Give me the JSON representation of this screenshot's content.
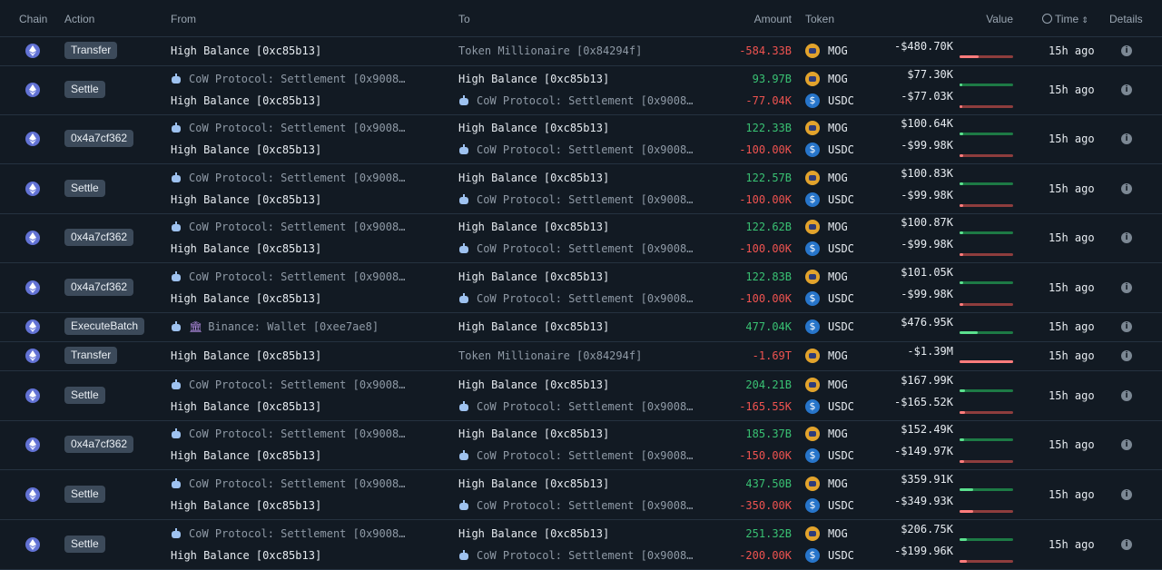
{
  "columns": {
    "chain": "Chain",
    "action": "Action",
    "from": "From",
    "to": "To",
    "amount": "Amount",
    "token": "Token",
    "value": "Value",
    "time": "Time",
    "details": "Details"
  },
  "rows": [
    {
      "action": "Transfer",
      "time": "15h ago",
      "lines": [
        {
          "from": "High Balance [0xc85b13]",
          "from_icon": "none",
          "to": "Token Millionaire [0x84294f]",
          "to_icon": "none",
          "to_dim": true,
          "amount": "-584.33B",
          "sign": "neg",
          "token": "MOG",
          "value": "-$480.70K",
          "fill": 0.35
        }
      ]
    },
    {
      "action": "Settle",
      "time": "15h ago",
      "lines": [
        {
          "from": "CoW Protocol: Settlement [0x9008…",
          "from_icon": "bot",
          "to": "High Balance [0xc85b13]",
          "to_icon": "none",
          "to_dim": false,
          "amount": "93.97B",
          "sign": "pos",
          "token": "MOG",
          "value": "$77.30K",
          "fill": 0.05
        },
        {
          "from": "High Balance [0xc85b13]",
          "from_icon": "none",
          "to": "CoW Protocol: Settlement [0x9008…",
          "to_icon": "bot",
          "to_dim": true,
          "amount": "-77.04K",
          "sign": "neg",
          "token": "USDC",
          "value": "-$77.03K",
          "fill": 0.05
        }
      ]
    },
    {
      "action": "0x4a7cf362",
      "time": "15h ago",
      "lines": [
        {
          "from": "CoW Protocol: Settlement [0x9008…",
          "from_icon": "bot",
          "to": "High Balance [0xc85b13]",
          "to_icon": "none",
          "to_dim": false,
          "amount": "122.33B",
          "sign": "pos",
          "token": "MOG",
          "value": "$100.64K",
          "fill": 0.06
        },
        {
          "from": "High Balance [0xc85b13]",
          "from_icon": "none",
          "to": "CoW Protocol: Settlement [0x9008…",
          "to_icon": "bot",
          "to_dim": true,
          "amount": "-100.00K",
          "sign": "neg",
          "token": "USDC",
          "value": "-$99.98K",
          "fill": 0.06
        }
      ]
    },
    {
      "action": "Settle",
      "time": "15h ago",
      "lines": [
        {
          "from": "CoW Protocol: Settlement [0x9008…",
          "from_icon": "bot",
          "to": "High Balance [0xc85b13]",
          "to_icon": "none",
          "to_dim": false,
          "amount": "122.57B",
          "sign": "pos",
          "token": "MOG",
          "value": "$100.83K",
          "fill": 0.06
        },
        {
          "from": "High Balance [0xc85b13]",
          "from_icon": "none",
          "to": "CoW Protocol: Settlement [0x9008…",
          "to_icon": "bot",
          "to_dim": true,
          "amount": "-100.00K",
          "sign": "neg",
          "token": "USDC",
          "value": "-$99.98K",
          "fill": 0.06
        }
      ]
    },
    {
      "action": "0x4a7cf362",
      "time": "15h ago",
      "lines": [
        {
          "from": "CoW Protocol: Settlement [0x9008…",
          "from_icon": "bot",
          "to": "High Balance [0xc85b13]",
          "to_icon": "none",
          "to_dim": false,
          "amount": "122.62B",
          "sign": "pos",
          "token": "MOG",
          "value": "$100.87K",
          "fill": 0.06
        },
        {
          "from": "High Balance [0xc85b13]",
          "from_icon": "none",
          "to": "CoW Protocol: Settlement [0x9008…",
          "to_icon": "bot",
          "to_dim": true,
          "amount": "-100.00K",
          "sign": "neg",
          "token": "USDC",
          "value": "-$99.98K",
          "fill": 0.06
        }
      ]
    },
    {
      "action": "0x4a7cf362",
      "time": "15h ago",
      "lines": [
        {
          "from": "CoW Protocol: Settlement [0x9008…",
          "from_icon": "bot",
          "to": "High Balance [0xc85b13]",
          "to_icon": "none",
          "to_dim": false,
          "amount": "122.83B",
          "sign": "pos",
          "token": "MOG",
          "value": "$101.05K",
          "fill": 0.06
        },
        {
          "from": "High Balance [0xc85b13]",
          "from_icon": "none",
          "to": "CoW Protocol: Settlement [0x9008…",
          "to_icon": "bot",
          "to_dim": true,
          "amount": "-100.00K",
          "sign": "neg",
          "token": "USDC",
          "value": "-$99.98K",
          "fill": 0.06
        }
      ]
    },
    {
      "action": "ExecuteBatch",
      "time": "15h ago",
      "lines": [
        {
          "from": "Binance: Wallet [0xee7ae8]",
          "from_icon": "bot-bank",
          "to": "High Balance [0xc85b13]",
          "to_icon": "none",
          "to_dim": false,
          "amount": "477.04K",
          "sign": "pos",
          "token": "USDC",
          "value": "$476.95K",
          "fill": 0.34
        }
      ]
    },
    {
      "action": "Transfer",
      "time": "15h ago",
      "lines": [
        {
          "from": "High Balance [0xc85b13]",
          "from_icon": "none",
          "to": "Token Millionaire [0x84294f]",
          "to_icon": "none",
          "to_dim": true,
          "amount": "-1.69T",
          "sign": "neg",
          "token": "MOG",
          "value": "-$1.39M",
          "fill": 1.0
        }
      ]
    },
    {
      "action": "Settle",
      "time": "15h ago",
      "lines": [
        {
          "from": "CoW Protocol: Settlement [0x9008…",
          "from_icon": "bot",
          "to": "High Balance [0xc85b13]",
          "to_icon": "none",
          "to_dim": false,
          "amount": "204.21B",
          "sign": "pos",
          "token": "MOG",
          "value": "$167.99K",
          "fill": 0.1
        },
        {
          "from": "High Balance [0xc85b13]",
          "from_icon": "none",
          "to": "CoW Protocol: Settlement [0x9008…",
          "to_icon": "bot",
          "to_dim": true,
          "amount": "-165.55K",
          "sign": "neg",
          "token": "USDC",
          "value": "-$165.52K",
          "fill": 0.1
        }
      ]
    },
    {
      "action": "0x4a7cf362",
      "time": "15h ago",
      "lines": [
        {
          "from": "CoW Protocol: Settlement [0x9008…",
          "from_icon": "bot",
          "to": "High Balance [0xc85b13]",
          "to_icon": "none",
          "to_dim": false,
          "amount": "185.37B",
          "sign": "pos",
          "token": "MOG",
          "value": "$152.49K",
          "fill": 0.09
        },
        {
          "from": "High Balance [0xc85b13]",
          "from_icon": "none",
          "to": "CoW Protocol: Settlement [0x9008…",
          "to_icon": "bot",
          "to_dim": true,
          "amount": "-150.00K",
          "sign": "neg",
          "token": "USDC",
          "value": "-$149.97K",
          "fill": 0.09
        }
      ]
    },
    {
      "action": "Settle",
      "time": "15h ago",
      "lines": [
        {
          "from": "CoW Protocol: Settlement [0x9008…",
          "from_icon": "bot",
          "to": "High Balance [0xc85b13]",
          "to_icon": "none",
          "to_dim": false,
          "amount": "437.50B",
          "sign": "pos",
          "token": "MOG",
          "value": "$359.91K",
          "fill": 0.25
        },
        {
          "from": "High Balance [0xc85b13]",
          "from_icon": "none",
          "to": "CoW Protocol: Settlement [0x9008…",
          "to_icon": "bot",
          "to_dim": true,
          "amount": "-350.00K",
          "sign": "neg",
          "token": "USDC",
          "value": "-$349.93K",
          "fill": 0.25
        }
      ]
    },
    {
      "action": "Settle",
      "time": "15h ago",
      "lines": [
        {
          "from": "CoW Protocol: Settlement [0x9008…",
          "from_icon": "bot",
          "to": "High Balance [0xc85b13]",
          "to_icon": "none",
          "to_dim": false,
          "amount": "251.32B",
          "sign": "pos",
          "token": "MOG",
          "value": "$206.75K",
          "fill": 0.13
        },
        {
          "from": "High Balance [0xc85b13]",
          "from_icon": "none",
          "to": "CoW Protocol: Settlement [0x9008…",
          "to_icon": "bot",
          "to_dim": true,
          "amount": "-200.00K",
          "sign": "neg",
          "token": "USDC",
          "value": "-$199.96K",
          "fill": 0.13
        }
      ]
    }
  ]
}
